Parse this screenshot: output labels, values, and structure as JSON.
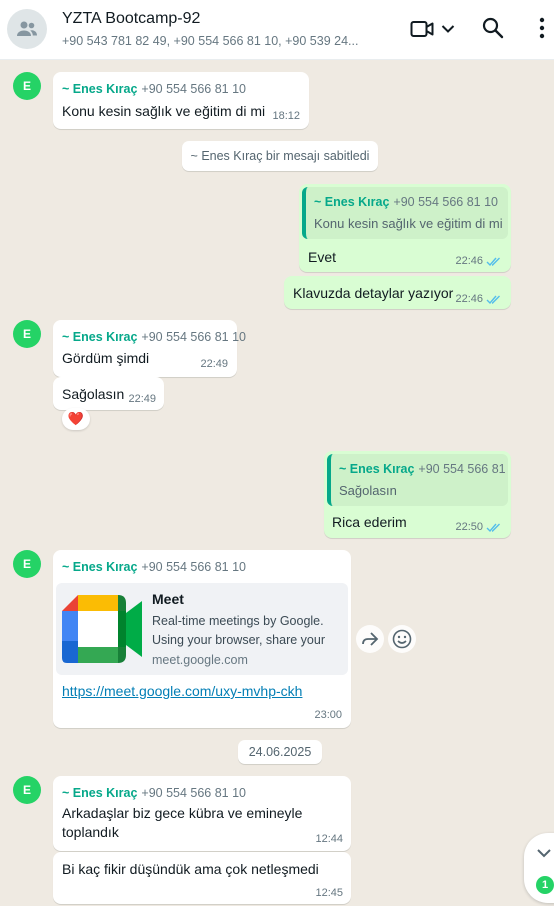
{
  "header": {
    "title": "YZTA Bootcamp-92",
    "subtitle": "+90 543 781 82 49, +90 554 566 81 10, +90 539 24..."
  },
  "icons": {
    "group_avatar": "group-icon",
    "video": "video-camera-icon",
    "dropdown": "chevron-down-icon",
    "search": "search-icon",
    "menu": "kebab-menu-icon",
    "forward": "forward-icon",
    "emoji": "emoji-icon",
    "scroll_down": "chevron-down-icon"
  },
  "colors": {
    "accent": "#06a88a",
    "outgoing_bubble": "#d9fdd3",
    "background": "#efeae2",
    "ticks": "#53bdeb"
  },
  "sender": {
    "name": "~ Enes Kıraç",
    "phone": "+90 554 566 81 10",
    "avatar_letter": "E"
  },
  "messages": {
    "m1": {
      "text": "Konu kesin sağlık ve eğitim di mi",
      "time": "18:12"
    },
    "pinned": "~ Enes Kıraç bir mesajı sabitledi",
    "m2": {
      "quote_text": "Konu kesin sağlık ve eğitim di mi",
      "text": "Evet",
      "time": "22:46"
    },
    "m3": {
      "text": "Klavuzda detaylar yazıyor",
      "time": "22:46"
    },
    "m4": {
      "text": "Gördüm şimdi",
      "time": "22:49"
    },
    "m5": {
      "text": "Sağolasın",
      "time": "22:49",
      "reaction": "❤️"
    },
    "m6": {
      "quote_text": "Sağolasın",
      "text": "Rica ederim",
      "time": "22:50"
    },
    "m7": {
      "card_title": "Meet",
      "card_desc": "Real-time meetings by Google. Using your browser, share your",
      "card_domain": "meet.google.com",
      "link": "https://meet.google.com/uxy-mvhp-ckh",
      "time": "23:00"
    },
    "date_divider": "24.06.2025",
    "m8": {
      "text": "Arkadaşlar biz gece kübra ve emineyle toplandık",
      "time": "12:44"
    },
    "m9": {
      "text": "Bi kaç fikir düşündük ama çok netleşmedi",
      "time": "12:45"
    }
  },
  "unread_count": "1"
}
